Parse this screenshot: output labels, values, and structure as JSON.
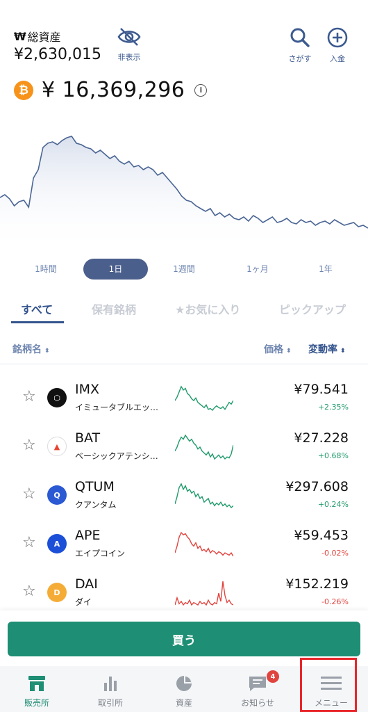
{
  "header": {
    "total_icon": "₩",
    "total_label": "総資産",
    "total_value": "¥2,630,015",
    "hide_label": "非表示",
    "search_label": "さがす",
    "deposit_label": "入金"
  },
  "price": {
    "coin_symbol": "₿",
    "value": "¥ 16,369,296",
    "info_symbol": "i"
  },
  "main_chart": {
    "color": "#4a6594",
    "values": [
      58,
      60,
      57,
      52,
      55,
      56,
      51,
      72,
      78,
      94,
      97,
      98,
      96,
      99,
      101,
      102,
      97,
      96,
      94,
      93,
      90,
      92,
      89,
      86,
      88,
      84,
      82,
      84,
      80,
      81,
      78,
      80,
      78,
      74,
      76,
      72,
      68,
      64,
      59,
      56,
      55,
      52,
      50,
      48,
      50,
      45,
      47,
      44,
      46,
      43,
      42,
      44,
      41,
      45,
      43,
      40,
      42,
      44,
      40,
      41,
      43,
      40,
      39,
      42,
      40,
      41,
      38,
      40,
      41,
      39,
      42,
      40,
      38,
      39,
      40,
      37,
      38,
      36
    ]
  },
  "periods": [
    "1時間",
    "1日",
    "1週間",
    "1ヶ月",
    "1年"
  ],
  "active_period": 1,
  "tabs": [
    "すべて",
    "保有銘柄",
    "★お気に入り",
    "ピックアップ"
  ],
  "sort": {
    "name": "銘柄名",
    "price": "価格",
    "change": "変動率",
    "arrow": "⬍"
  },
  "coins": [
    {
      "symbol": "IMX",
      "name": "イミュータブルエッ…",
      "price": "¥79.541",
      "change": "+2.35%",
      "dir": "up",
      "icon_text": "⬡",
      "icon_bg": "#111111",
      "spark_color": "#1f9a6b",
      "spark": [
        30,
        34,
        40,
        46,
        42,
        44,
        38,
        36,
        32,
        30,
        33,
        28,
        26,
        24,
        22,
        25,
        20,
        21,
        19,
        22,
        24,
        22,
        21,
        23,
        20,
        24,
        28,
        26,
        30
      ]
    },
    {
      "symbol": "BAT",
      "name": "ベーシックアテンシ…",
      "price": "¥27.228",
      "change": "+0.68%",
      "dir": "up",
      "icon_text": "▲",
      "icon_bg": "#ffffff",
      "spark_color": "#1f9a6b",
      "spark": [
        28,
        32,
        38,
        42,
        40,
        44,
        41,
        38,
        40,
        36,
        34,
        30,
        32,
        28,
        26,
        24,
        27,
        22,
        25,
        20,
        22,
        24,
        21,
        23,
        20,
        22,
        21,
        25,
        34
      ]
    },
    {
      "symbol": "QTUM",
      "name": "クアンタム",
      "price": "¥297.608",
      "change": "+0.24%",
      "dir": "up",
      "icon_text": "Q",
      "icon_bg": "#2b59d4",
      "spark_color": "#1f9a6b",
      "spark": [
        22,
        30,
        40,
        44,
        38,
        42,
        36,
        38,
        34,
        36,
        30,
        33,
        28,
        30,
        24,
        26,
        28,
        22,
        24,
        20,
        23,
        21,
        24,
        20,
        22,
        19,
        21,
        18,
        20
      ]
    },
    {
      "symbol": "APE",
      "name": "エイプコイン",
      "price": "¥59.453",
      "change": "-0.02%",
      "dir": "down",
      "icon_text": "A",
      "icon_bg": "#1b4fd8",
      "spark_color": "#e0443e",
      "spark": [
        24,
        30,
        38,
        42,
        40,
        41,
        38,
        36,
        32,
        30,
        33,
        28,
        30,
        26,
        27,
        25,
        28,
        24,
        26,
        25,
        23,
        25,
        24,
        22,
        24,
        23,
        22,
        24,
        21
      ]
    },
    {
      "symbol": "DAI",
      "name": "ダイ",
      "price": "¥152.219",
      "change": "-0.26%",
      "dir": "down",
      "icon_text": "D",
      "icon_bg": "#f5ac37",
      "spark_color": "#e0443e",
      "spark": [
        20,
        26,
        21,
        23,
        20,
        22,
        21,
        24,
        20,
        22,
        21,
        20,
        23,
        21,
        22,
        20,
        24,
        21,
        20,
        22,
        21,
        30,
        23,
        40,
        28,
        22,
        24,
        21,
        20
      ]
    }
  ],
  "buy_label": "買う",
  "nav": [
    {
      "label": "販売所",
      "icon": "shop-icon",
      "active": true
    },
    {
      "label": "取引所",
      "icon": "bar-chart-icon",
      "active": false
    },
    {
      "label": "資産",
      "icon": "pie-chart-icon",
      "active": false
    },
    {
      "label": "お知らせ",
      "icon": "message-icon",
      "active": false,
      "badge": "4"
    },
    {
      "label": "メニュー",
      "icon": "hamburger-icon",
      "active": false
    }
  ],
  "colors": {
    "accent": "#33538c",
    "buy": "#1e8e74",
    "up": "#1f9a6b",
    "down": "#e0443e",
    "highlight": "#e8262b"
  }
}
